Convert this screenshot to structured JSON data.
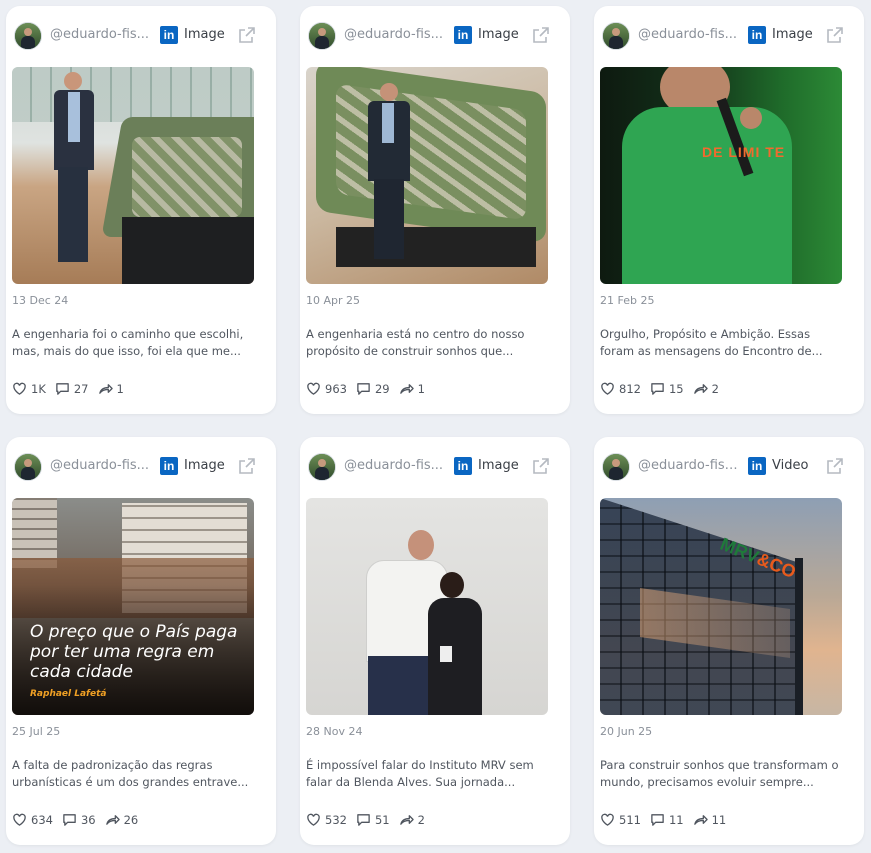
{
  "colors": {
    "linkedin": "#0a66c2",
    "background": "#eceff4",
    "card": "#ffffff"
  },
  "posts": [
    {
      "handle": "@eduardo-fis...",
      "network_icon": "linkedin-icon",
      "type": "Image",
      "date": "13 Dec 24",
      "caption": "A engenharia foi o caminho que escolhi, mas, mais do que isso, foi ela que me...",
      "likes": "1K",
      "comments": "27",
      "shares": "1"
    },
    {
      "handle": "@eduardo-fis...",
      "network_icon": "linkedin-icon",
      "type": "Image",
      "date": "10 Apr 25",
      "caption": "A engenharia está no centro do nosso propósito de construir sonhos que...",
      "likes": "963",
      "comments": "29",
      "shares": "1"
    },
    {
      "handle": "@eduardo-fis...",
      "network_icon": "linkedin-icon",
      "type": "Image",
      "date": "21 Feb 25",
      "caption": "Orgulho, Propósito e Ambição. Essas foram as mensagens do Encontro de...",
      "likes": "812",
      "comments": "15",
      "shares": "2",
      "shirt_text": "DE LIMI TE"
    },
    {
      "handle": "@eduardo-fis...",
      "network_icon": "linkedin-icon",
      "type": "Image",
      "date": "25 Jul 25",
      "caption": "A falta de padronização das regras urbanísticas é um dos grandes entrave...",
      "likes": "634",
      "comments": "36",
      "shares": "26",
      "overlay_text": "O preço que o País paga por ter uma regra em cada cidade",
      "overlay_author": "Raphael Lafetá"
    },
    {
      "handle": "@eduardo-fis...",
      "network_icon": "linkedin-icon",
      "type": "Image",
      "date": "28 Nov 24",
      "caption": "É impossível falar do Instituto MRV sem falar da Blenda Alves. Sua jornada...",
      "likes": "532",
      "comments": "51",
      "shares": "2"
    },
    {
      "handle": "@eduardo-fisc...",
      "network_icon": "linkedin-icon",
      "type": "Video",
      "date": "20 Jun 25",
      "caption": "Para construir sonhos que transformam o mundo, precisamos evoluir sempre...",
      "likes": "511",
      "comments": "11",
      "shares": "11",
      "logo_text": "MRV",
      "logo_suffix": "&CO"
    }
  ]
}
